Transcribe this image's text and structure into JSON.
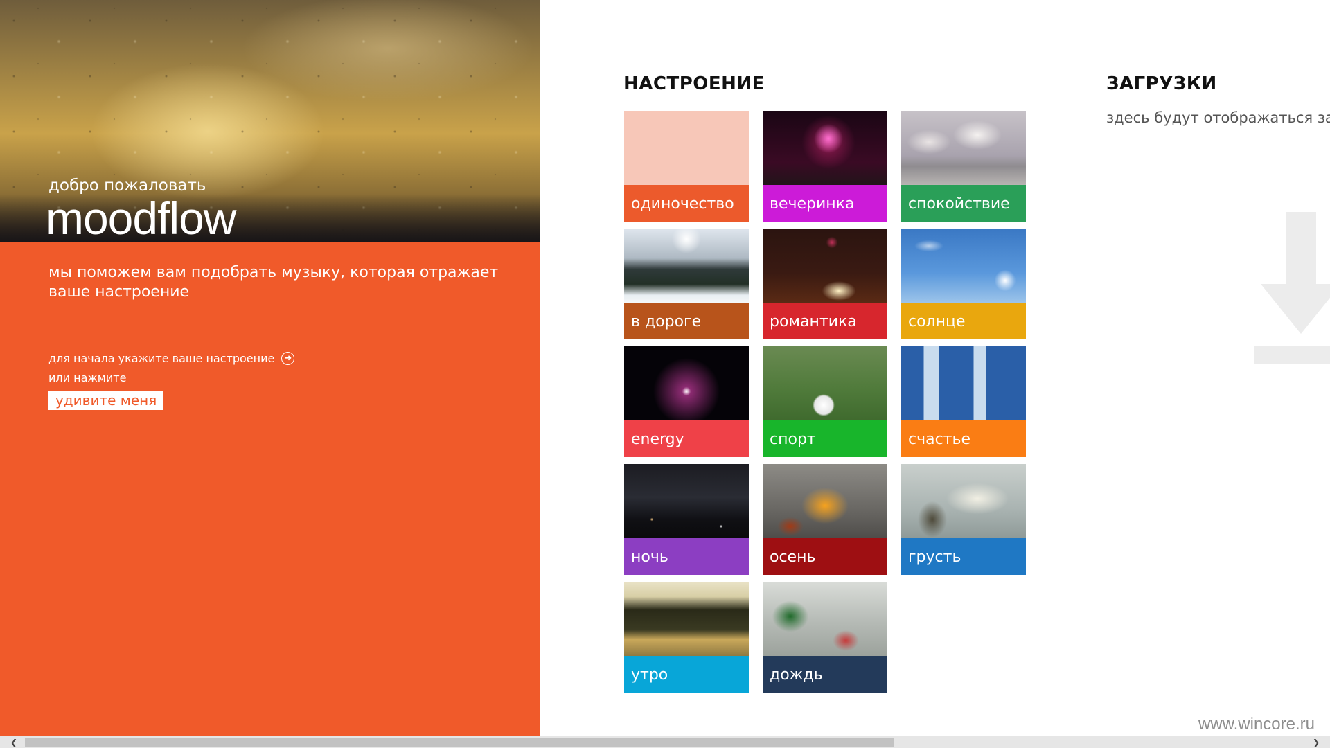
{
  "welcome": {
    "greeting": "добро пожаловать",
    "logo": "moodflow",
    "tagline": "мы поможем вам подобрать музыку, которая отражает ваше настроение",
    "hint": "для начала укажите ваше настроение",
    "or_press": "или нажмите",
    "surprise_button": "удивите меня",
    "panel_color": "#f05a2a"
  },
  "mood": {
    "title": "НАСТРОЕНИЕ",
    "tiles": [
      {
        "label": "одиночество",
        "color": "#ec5a2c",
        "image": "peach-blank"
      },
      {
        "label": "вечеринка",
        "color": "#cc1bd8",
        "image": "fireworks"
      },
      {
        "label": "спокойствие",
        "color": "#2a9f58",
        "image": "clouds-over-sea"
      },
      {
        "label": "в дороге",
        "color": "#b8541b",
        "image": "snowy-mountain-road"
      },
      {
        "label": "романтика",
        "color": "#d7262d",
        "image": "candle-bokeh"
      },
      {
        "label": "солнце",
        "color": "#e9a70e",
        "image": "sun-in-sky"
      },
      {
        "label": "energy",
        "color": "#ef4148",
        "image": "plasma-ball"
      },
      {
        "label": "спорт",
        "color": "#18b52b",
        "image": "football-on-grass"
      },
      {
        "label": "счастье",
        "color": "#fa7d14",
        "image": "graffiti-letters"
      },
      {
        "label": "ночь",
        "color": "#8c3ec2",
        "image": "night-city"
      },
      {
        "label": "осень",
        "color": "#9e0f12",
        "image": "autumn-leaf"
      },
      {
        "label": "грусть",
        "color": "#1f78c4",
        "image": "wilted-flower"
      },
      {
        "label": "утро",
        "color": "#08a6d8",
        "image": "misty-lake"
      },
      {
        "label": "дождь",
        "color": "#233a5a",
        "image": "rain-on-glass"
      }
    ]
  },
  "downloads": {
    "title": "ЗАГРУЗКИ",
    "empty_text": "здесь будут отображаться заг",
    "icon": "download-arrow-icon"
  },
  "watermark": "www.wincore.ru",
  "scrollbar": {
    "left_icon": "chevron-left-icon",
    "right_icon": "chevron-right-icon"
  }
}
